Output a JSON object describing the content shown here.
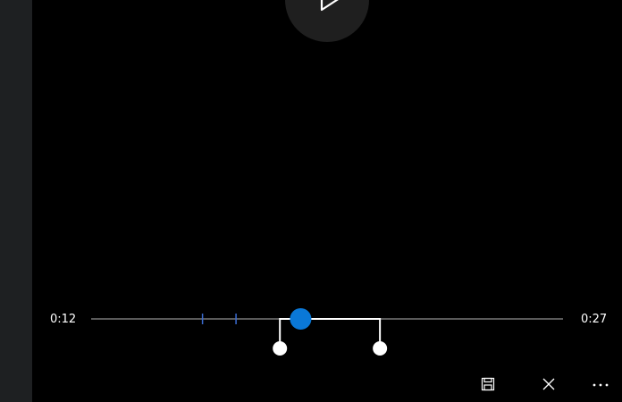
{
  "player": {
    "current_time": "0:12",
    "total_time": "0:27",
    "playhead_position_fraction": 0.444,
    "trim_start_fraction": 0.4,
    "trim_end_fraction": 0.612,
    "marker_fractions": [
      0.236,
      0.307
    ]
  },
  "toolbar": {
    "icons": [
      "save-icon",
      "close-icon",
      "more-icon"
    ]
  },
  "colors": {
    "background": "#000000",
    "side_panel": "#1e2022",
    "play_button": "#1f1f1f",
    "track": "#5a5a5a",
    "accent": "#0a78d7",
    "marker": "#3a6bd0",
    "selection": "#ffffff"
  }
}
